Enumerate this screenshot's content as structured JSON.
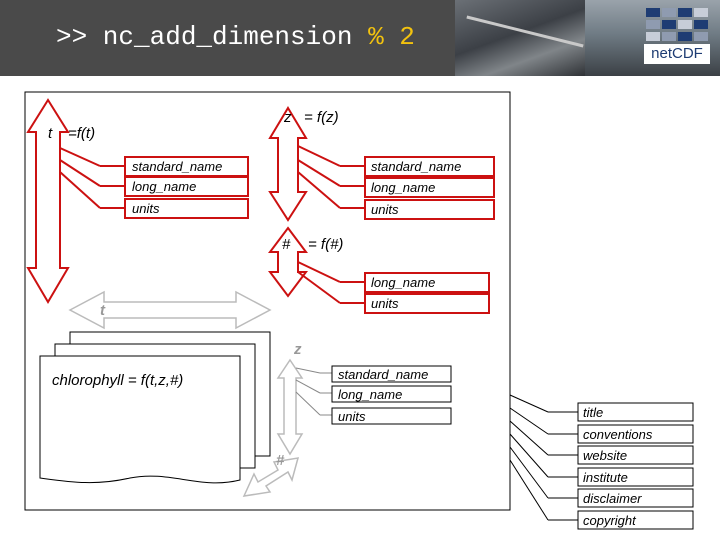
{
  "header": {
    "title_prefix": ">> nc_add_dimension ",
    "title_accent": "% 2",
    "logo_text": "netCDF"
  },
  "dimensions": {
    "t_label": "t",
    "t_formula": "=f(t)",
    "z_label": "z",
    "z_formula": "= f(z)",
    "hash_label": "#",
    "hash_formula": "= f(#)"
  },
  "t_attributes": [
    "standard_name",
    "long_name",
    "units"
  ],
  "z_attributes": [
    "standard_name",
    "long_name",
    "units"
  ],
  "hash_attributes": [
    "long_name",
    "units"
  ],
  "variable": {
    "name": "chlorophyll = f(t,z,#)",
    "attributes": [
      "standard_name",
      "long_name",
      "units"
    ],
    "axis_t": "t",
    "axis_z": "z",
    "axis_hash": "#"
  },
  "global_attributes": [
    "title",
    "conventions",
    "website",
    "institute",
    "disclaimer",
    "copyright"
  ],
  "colors": {
    "header_bg": "#4a4a4a",
    "accent": "#f2c20f",
    "dimension_red": "#cc1111",
    "inactive_grey": "#bbbbbb"
  }
}
